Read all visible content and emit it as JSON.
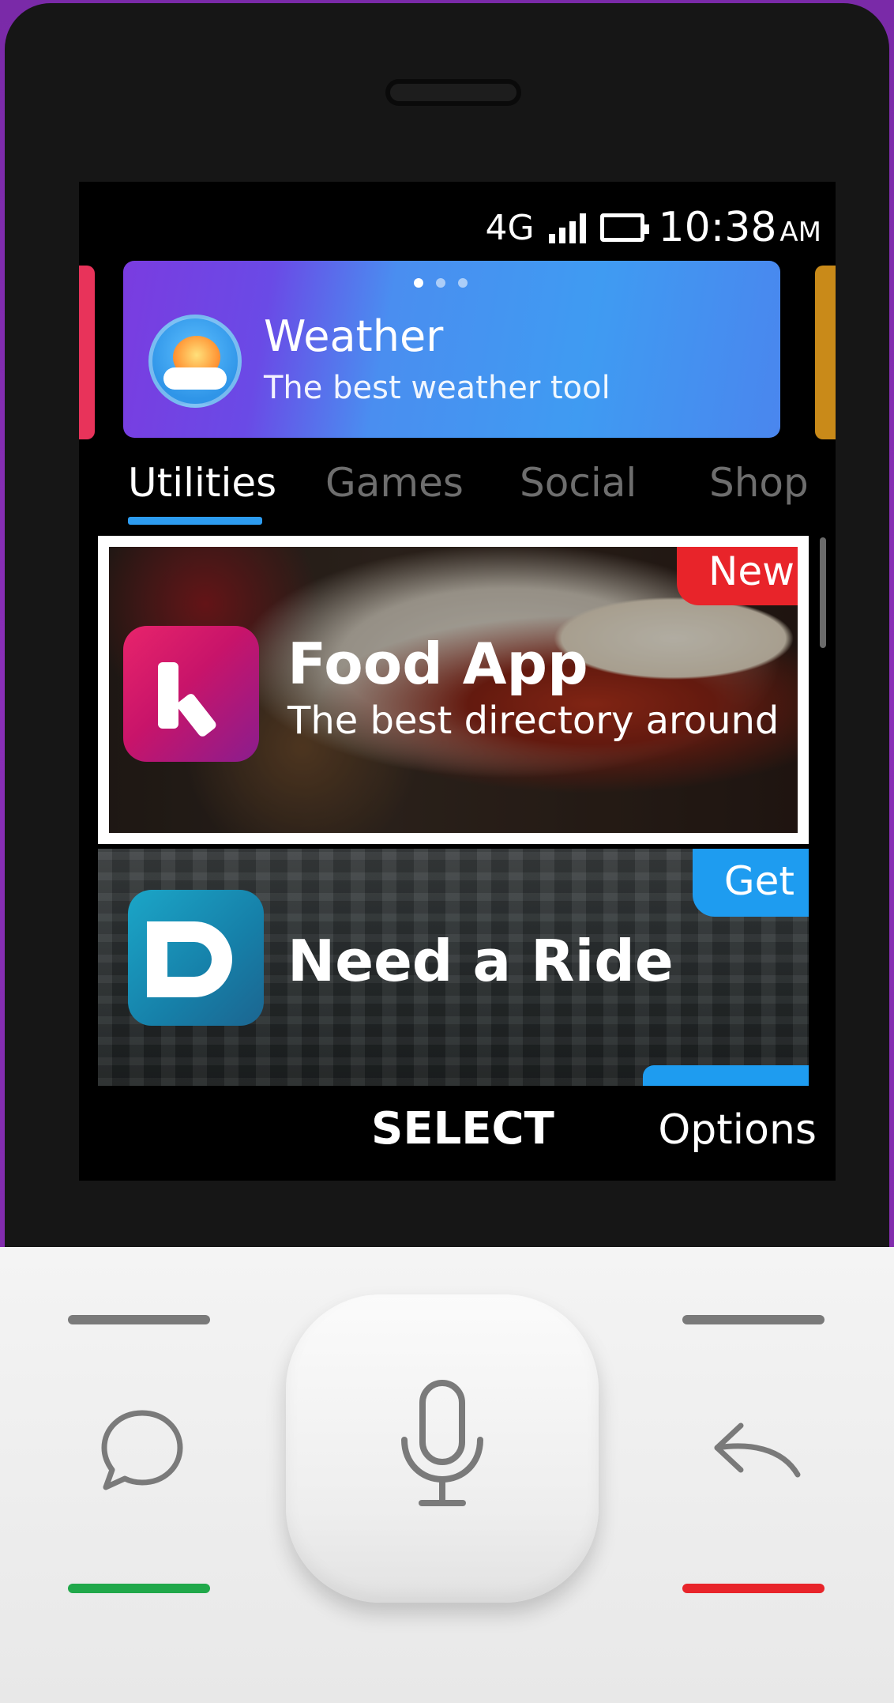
{
  "status_bar": {
    "network": "4G",
    "time": "10:38",
    "ampm": "AM",
    "icons": [
      "signal-icon",
      "battery-icon"
    ]
  },
  "carousel": {
    "title": "Weather",
    "subtitle": "The best weather tool",
    "page_indicator": {
      "count": 3,
      "active": 1
    }
  },
  "tabs": [
    {
      "label": "Utilities",
      "active": true
    },
    {
      "label": "Games",
      "active": false
    },
    {
      "label": "Social",
      "active": false
    },
    {
      "label": "Shop",
      "active": false
    }
  ],
  "cards": [
    {
      "title": "Food App",
      "subtitle": "The best directory around",
      "badge": "New",
      "selected": true
    },
    {
      "title": "Need a Ride",
      "badge": "Get",
      "selected": false
    }
  ],
  "softkeys": {
    "center": "SELECT",
    "right": "Options"
  },
  "colors": {
    "background": "#8a2fb8",
    "accent": "#2d9cf0",
    "badge_new": "#e8242a",
    "badge_get": "#1e9cf0",
    "call_green": "#20a84a",
    "end_red": "#e8242a"
  }
}
